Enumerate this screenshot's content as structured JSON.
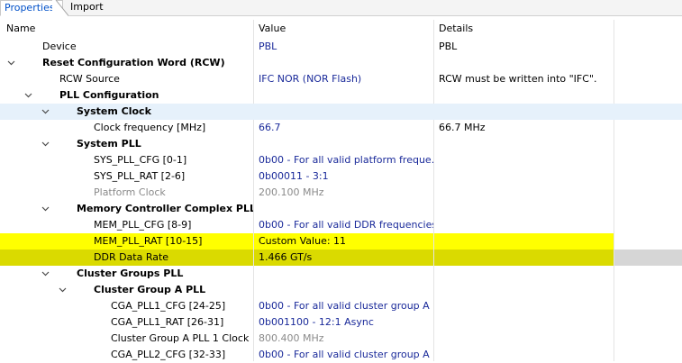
{
  "tabs": [
    {
      "label": "Properties",
      "active": true
    },
    {
      "label": "Import",
      "active": false
    }
  ],
  "columns": {
    "name": "Name",
    "value": "Value",
    "details": "Details"
  },
  "colors": {
    "selected_row": "#e6f1fb",
    "highlight": "#ffff00",
    "highlight_dark": "#dada00",
    "value_text": "#1a2a9a",
    "disabled_text": "#8a8a8a"
  },
  "rows": [
    {
      "name": "Device",
      "value": "PBL",
      "details": "PBL"
    },
    {
      "name": "Reset Configuration Word (RCW)",
      "value": "",
      "details": ""
    },
    {
      "name": "RCW Source",
      "value": "IFC NOR (NOR Flash)",
      "details": "RCW must be written into  \"IFC\"."
    },
    {
      "name": "PLL Configuration",
      "value": "",
      "details": ""
    },
    {
      "name": "System Clock",
      "value": "",
      "details": ""
    },
    {
      "name": "Clock frequency [MHz]",
      "value": "66.7",
      "details": "66.7 MHz"
    },
    {
      "name": "System PLL",
      "value": "",
      "details": ""
    },
    {
      "name": "SYS_PLL_CFG  [0-1]",
      "value": "0b00 - For all valid platform freque...",
      "details": ""
    },
    {
      "name": "SYS_PLL_RAT  [2-6]",
      "value": "0b00011 - 3:1",
      "details": ""
    },
    {
      "name": "Platform Clock",
      "value": "200.100 MHz",
      "details": ""
    },
    {
      "name": "Memory Controller Complex PLL",
      "value": "",
      "details": ""
    },
    {
      "name": "MEM_PLL_CFG  [8-9]",
      "value": "0b00 - For all valid DDR frequencies",
      "details": ""
    },
    {
      "name": "MEM_PLL_RAT  [10-15]",
      "value": "Custom Value: 11",
      "details": ""
    },
    {
      "name": "DDR Data Rate",
      "value": "1.466 GT/s",
      "details": ""
    },
    {
      "name": "Cluster Groups PLL",
      "value": "",
      "details": ""
    },
    {
      "name": "Cluster Group A PLL",
      "value": "",
      "details": ""
    },
    {
      "name": "CGA_PLL1_CFG  [24-25]",
      "value": "0b00 - For all valid cluster group A ...",
      "details": ""
    },
    {
      "name": "CGA_PLL1_RAT  [26-31]",
      "value": "0b001100 - 12:1 Async",
      "details": ""
    },
    {
      "name": "Cluster Group A PLL 1 Clock",
      "value": "800.400 MHz",
      "details": ""
    },
    {
      "name": "CGA_PLL2_CFG  [32-33]",
      "value": "0b00 - For all valid cluster group A ...",
      "details": ""
    }
  ]
}
